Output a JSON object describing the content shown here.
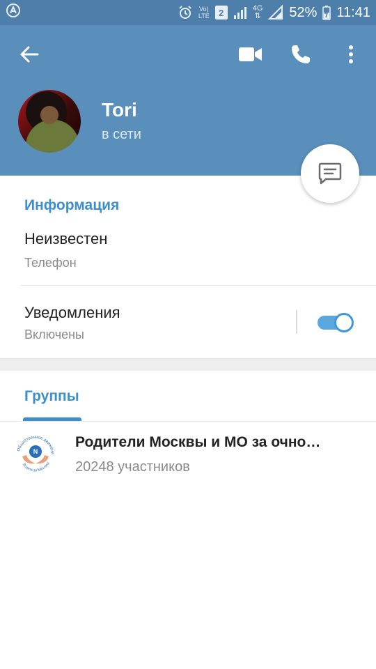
{
  "status_bar": {
    "sim_slot": "2",
    "network_label_top": "Vo)",
    "network_label_bottom": "LTE",
    "data_type": "4G",
    "battery": "52%",
    "time": "11:41"
  },
  "header": {
    "name": "Tori",
    "status": "в сети"
  },
  "info": {
    "title": "Информация",
    "phone_value": "Неизвестен",
    "phone_label": "Телефон",
    "notifications_title": "Уведомления",
    "notifications_value": "Включены",
    "notifications_enabled": true
  },
  "groups": {
    "tab_label": "Группы",
    "items": [
      {
        "name": "Родители Москвы и МО за очно…",
        "members": "20248 участников",
        "avatar_text_top": "Общественное движение",
        "avatar_text_bottom": "Родители Москвы"
      }
    ]
  },
  "colors": {
    "header": "#5a8fbb",
    "status_bar": "#4e7fab",
    "accent": "#3d8fcc",
    "toggle_on": "#5aa7e0"
  },
  "icons": {
    "back": "arrow-left-icon",
    "video": "video-camera-icon",
    "call": "phone-icon",
    "menu": "more-vertical-icon",
    "message": "chat-bubble-icon"
  }
}
